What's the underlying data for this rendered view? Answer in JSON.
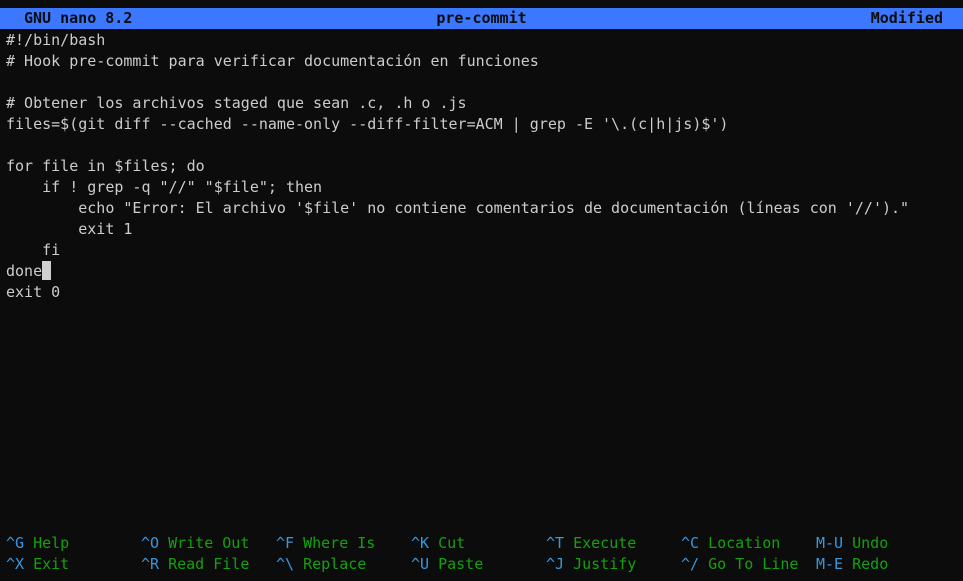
{
  "titlebar": {
    "app": "GNU nano 8.2",
    "filename": "pre-commit",
    "status": "Modified"
  },
  "editor": {
    "lines": [
      "#!/bin/bash",
      "# Hook pre-commit para verificar documentación en funciones",
      "",
      "# Obtener los archivos staged que sean .c, .h o .js",
      "files=$(git diff --cached --name-only --diff-filter=ACM | grep -E '\\.(c|h|js)$')",
      "",
      "for file in $files; do",
      "    if ! grep -q \"//\" \"$file\"; then",
      "        echo \"Error: El archivo '$file' no contiene comentarios de documentación (líneas con '//').\"",
      "        exit 1",
      "    fi",
      "done",
      "exit 0"
    ],
    "cursor_line": 11
  },
  "shortcuts": {
    "row1": [
      {
        "key": "^G",
        "label": "Help"
      },
      {
        "key": "^O",
        "label": "Write Out"
      },
      {
        "key": "^F",
        "label": "Where Is"
      },
      {
        "key": "^K",
        "label": "Cut"
      },
      {
        "key": "^T",
        "label": "Execute"
      },
      {
        "key": "^C",
        "label": "Location"
      },
      {
        "key": "M-U",
        "label": "Undo"
      }
    ],
    "row2": [
      {
        "key": "^X",
        "label": "Exit"
      },
      {
        "key": "^R",
        "label": "Read File"
      },
      {
        "key": "^\\",
        "label": "Replace"
      },
      {
        "key": "^U",
        "label": "Paste"
      },
      {
        "key": "^J",
        "label": "Justify"
      },
      {
        "key": "^/",
        "label": "Go To Line"
      },
      {
        "key": "M-E",
        "label": "Redo"
      }
    ]
  },
  "colors": {
    "background": "#0c0c0c",
    "titlebar": "#3b78ff",
    "text": "#cccccc",
    "shortcut": "#13a10e"
  }
}
